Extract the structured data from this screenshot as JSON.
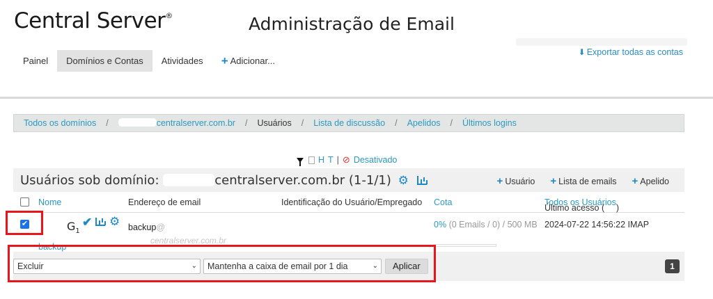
{
  "brand": {
    "name": "Central Server",
    "mark": "®"
  },
  "page_title": "Administração de Email",
  "nav": {
    "items": [
      {
        "label": "Painel",
        "active": false
      },
      {
        "label": "Domínios e Contas",
        "active": true
      },
      {
        "label": "Atividades",
        "active": false
      }
    ],
    "add_label": "Adicionar..."
  },
  "export_label": "Exportar todas as contas",
  "breadcrumb": {
    "all_domains": "Todos os domínios",
    "domain": "centralserver.com.br",
    "users": "Usuários",
    "lists": "Lista de discussão",
    "aliases": "Apelidos",
    "last_logins": "Últimos logins",
    "separator": "/"
  },
  "filters": {
    "h": "H",
    "t": "T",
    "pipe": "|",
    "disabled": "Desativado"
  },
  "panel": {
    "title_prefix": "Usuários sob domínio:",
    "title_domain": "centralserver.com.br",
    "title_count": "(1-1/1)",
    "actions": {
      "user": "Usuário",
      "email_list": "Lista de emails",
      "alias": "Apelido"
    }
  },
  "columns": {
    "name": "Nome",
    "email": "Endereço de email",
    "identification": "Identificação do Usuário/Empregado",
    "quota": "Cota",
    "last_access": "Último acesso (",
    "all_users": "Todos os Usuários",
    "last_access_close": ")"
  },
  "row": {
    "display_name": "G",
    "display_suffix": "1",
    "username": "backup",
    "email_user": "backup",
    "email_at": "@",
    "email_domain": "centralserver.com.br",
    "quota_pct": "0%",
    "quota_detail": "(0 Emails / 0) / 500 MB",
    "last_access": "2024-07-22 14:56:22 IMAP"
  },
  "bulk": {
    "action_value": "Excluir",
    "keep_value": "Mantenha a caixa de email por 1 dia",
    "apply_label": "Aplicar",
    "page": "1"
  },
  "colors": {
    "accent": "#2b98c4",
    "highlight": "#e8161b"
  }
}
